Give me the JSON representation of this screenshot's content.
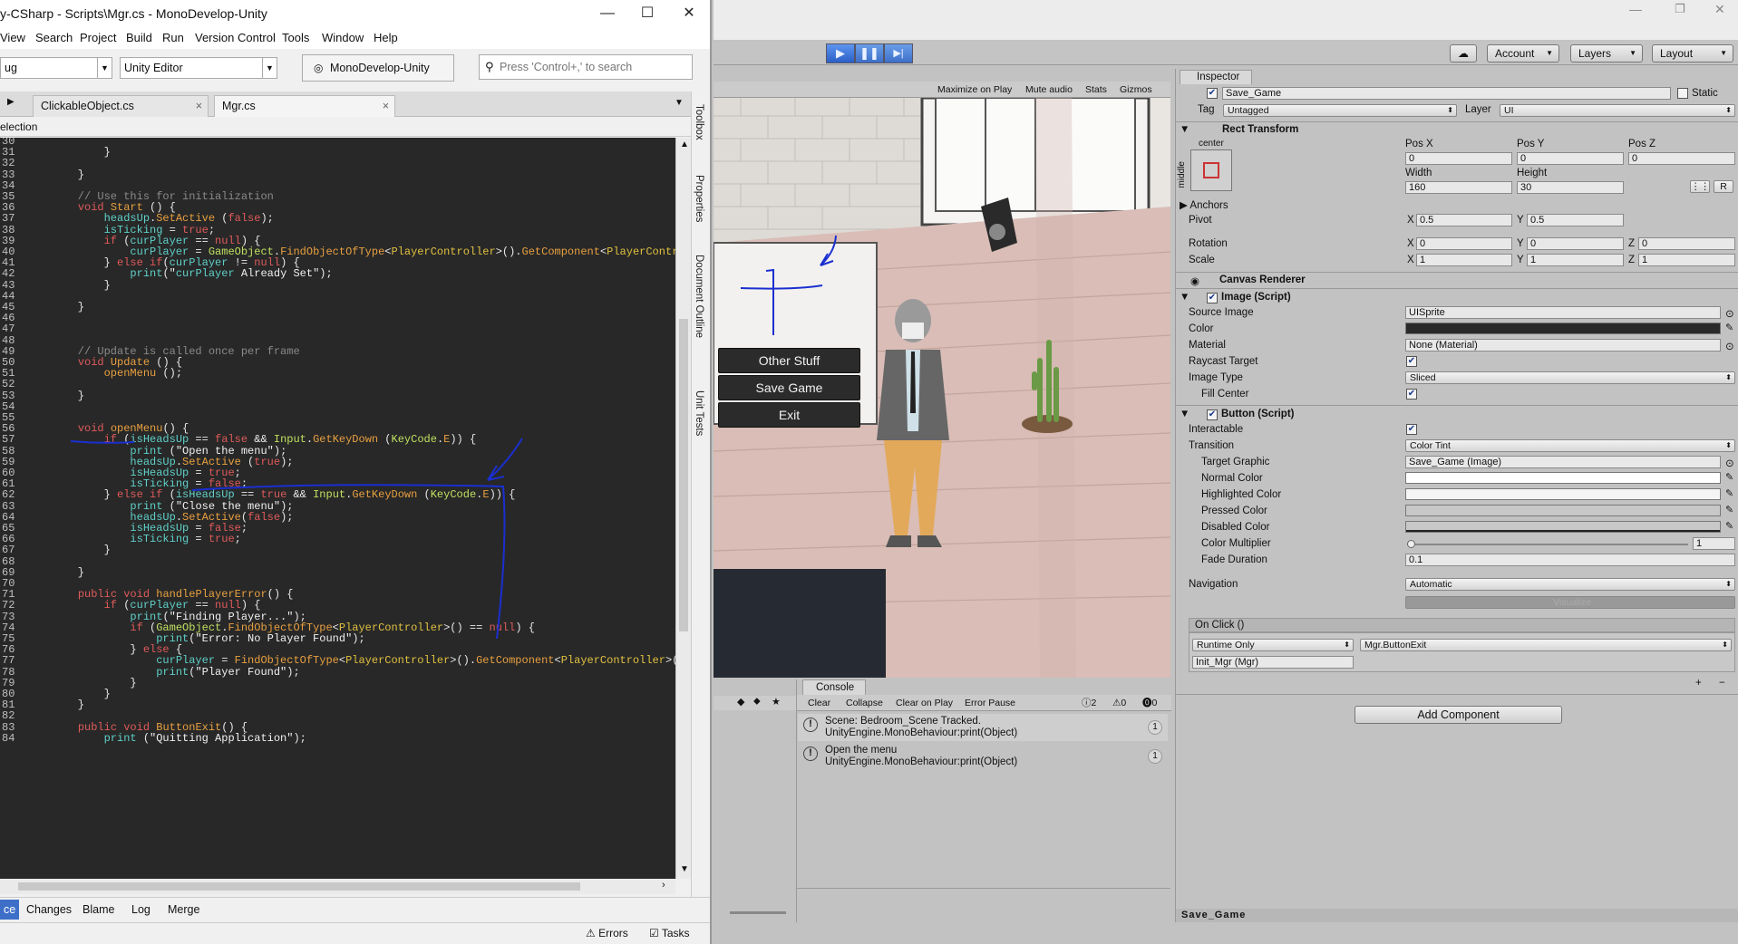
{
  "md": {
    "title": "y-CSharp - Scripts\\Mgr.cs - MonoDevelop-Unity",
    "window_controls": [
      "—",
      "☐",
      "✕"
    ],
    "menu": [
      "View",
      "Search",
      "Project",
      "Build",
      "Run",
      "Version Control",
      "Tools",
      "Window",
      "Help"
    ],
    "config": "ug",
    "target": "Unity Editor",
    "app_button": "MonoDevelop-Unity",
    "search_placeholder": "Press 'Control+,' to search",
    "tabs": [
      "ClickableObject.cs",
      "Mgr.cs"
    ],
    "tab_close": "×",
    "selection_label": "election",
    "side_tools": [
      "Toolbox",
      "Properties",
      "Document Outline",
      "Unit Tests"
    ],
    "bottom_tabs": [
      "ce",
      "Changes",
      "Blame",
      "Log",
      "Merge"
    ],
    "status": [
      "Errors",
      "Tasks"
    ],
    "code": [
      {
        "n": "30",
        "t": ""
      },
      {
        "n": "31",
        "t": "        }"
      },
      {
        "n": "32",
        "t": ""
      },
      {
        "n": "33",
        "t": "    }"
      },
      {
        "n": "34",
        "t": ""
      },
      {
        "n": "35",
        "t": "    // Use this for initialization",
        "c": "cm"
      },
      {
        "n": "36",
        "t": "    void Start () {"
      },
      {
        "n": "37",
        "t": "        headsUp.SetActive (false);"
      },
      {
        "n": "38",
        "t": "        isTicking = true;"
      },
      {
        "n": "39",
        "t": "        if (curPlayer == null) {"
      },
      {
        "n": "40",
        "t": "            curPlayer = GameObject.FindObjectOfType<PlayerController>().GetComponent<PlayerController>"
      },
      {
        "n": "41",
        "t": "        } else if(curPlayer != null) {"
      },
      {
        "n": "42",
        "t": "            print(\"curPlayer Already Set\");"
      },
      {
        "n": "43",
        "t": "        }"
      },
      {
        "n": "44",
        "t": ""
      },
      {
        "n": "45",
        "t": "    }"
      },
      {
        "n": "46",
        "t": ""
      },
      {
        "n": "47",
        "t": ""
      },
      {
        "n": "48",
        "t": ""
      },
      {
        "n": "49",
        "t": "    // Update is called once per frame",
        "c": "cm"
      },
      {
        "n": "50",
        "t": "    void Update () {"
      },
      {
        "n": "51",
        "t": "        openMenu ();"
      },
      {
        "n": "52",
        "t": ""
      },
      {
        "n": "53",
        "t": "    }"
      },
      {
        "n": "54",
        "t": ""
      },
      {
        "n": "55",
        "t": ""
      },
      {
        "n": "56",
        "t": "    void openMenu() {"
      },
      {
        "n": "57",
        "t": "        if (isHeadsUp == false && Input.GetKeyDown (KeyCode.E)) {"
      },
      {
        "n": "58",
        "t": "            print (\"Open the menu\");"
      },
      {
        "n": "59",
        "t": "            headsUp.SetActive (true);"
      },
      {
        "n": "60",
        "t": "            isHeadsUp = true;"
      },
      {
        "n": "61",
        "t": "            isTicking = false;"
      },
      {
        "n": "62",
        "t": "        } else if (isHeadsUp == true && Input.GetKeyDown (KeyCode.E)) {"
      },
      {
        "n": "63",
        "t": "            print (\"Close the menu\");"
      },
      {
        "n": "64",
        "t": "            headsUp.SetActive(false);"
      },
      {
        "n": "65",
        "t": "            isHeadsUp = false;"
      },
      {
        "n": "66",
        "t": "            isTicking = true;"
      },
      {
        "n": "67",
        "t": "        }"
      },
      {
        "n": "68",
        "t": ""
      },
      {
        "n": "69",
        "t": "    }"
      },
      {
        "n": "70",
        "t": ""
      },
      {
        "n": "71",
        "t": "    public void handlePlayerError() {"
      },
      {
        "n": "72",
        "t": "        if (curPlayer == null) {"
      },
      {
        "n": "73",
        "t": "            print(\"Finding Player...\");"
      },
      {
        "n": "74",
        "t": "            if (GameObject.FindObjectOfType<PlayerController>() == null) {"
      },
      {
        "n": "75",
        "t": "                print(\"Error: No Player Found\");"
      },
      {
        "n": "76",
        "t": "            } else {"
      },
      {
        "n": "77",
        "t": "                curPlayer = FindObjectOfType<PlayerController>().GetComponent<PlayerController>();"
      },
      {
        "n": "78",
        "t": "                print(\"Player Found\");"
      },
      {
        "n": "79",
        "t": "            }"
      },
      {
        "n": "80",
        "t": "        }"
      },
      {
        "n": "81",
        "t": "    }"
      },
      {
        "n": "82",
        "t": ""
      },
      {
        "n": "83",
        "t": "    public void ButtonExit() {"
      },
      {
        "n": "84",
        "t": "        print (\"Quitting Application\");"
      }
    ]
  },
  "unity": {
    "window_controls": [
      "—",
      "❐",
      "✕"
    ],
    "play_controls": [
      "▶",
      "❚❚",
      "▶|"
    ],
    "toolbar": {
      "cloud": "☁",
      "account": "Account",
      "layers": "Layers",
      "layout": "Layout"
    },
    "gamebar": [
      "Maximize on Play",
      "Mute audio",
      "Stats",
      "Gizmos"
    ],
    "menu_buttons": [
      "Other Stuff",
      "Save Game",
      "Exit"
    ],
    "console": {
      "tab": "Console",
      "buttons": [
        "Clear",
        "Collapse",
        "Clear on Play",
        "Error Pause"
      ],
      "counts": [
        "2",
        "0",
        "0"
      ],
      "rows": [
        {
          "text": "Scene: Bedroom_Scene Tracked.\nUnityEngine.MonoBehaviour:print(Object)",
          "count": "1"
        },
        {
          "text": "Open the menu\nUnityEngine.MonoBehaviour:print(Object)",
          "count": "1"
        }
      ]
    },
    "inspector": {
      "tab": "Inspector",
      "object_name": "Save_Game",
      "static": "Static",
      "tag_label": "Tag",
      "tag": "Untagged",
      "layer_label": "Layer",
      "layer": "UI",
      "rect_transform": "Rect Transform",
      "anchor_h": "center",
      "anchor_v": "middle",
      "pos_labels": [
        "Pos X",
        "Pos Y",
        "Pos Z"
      ],
      "pos": [
        "0",
        "0",
        "0"
      ],
      "size_labels": [
        "Width",
        "Height"
      ],
      "size": [
        "160",
        "30"
      ],
      "r_button": "R",
      "anchors": "Anchors",
      "pivot": "Pivot",
      "pivot_vals": [
        "0.5",
        "0.5"
      ],
      "rotation": "Rotation",
      "rotation_vals": [
        "0",
        "0",
        "0"
      ],
      "scale": "Scale",
      "scale_vals": [
        "1",
        "1",
        "1"
      ],
      "canvas_renderer": "Canvas Renderer",
      "image_script": "Image (Script)",
      "image_fields": {
        "source_image": "Source Image",
        "source_val": "UISprite",
        "color": "Color",
        "material": "Material",
        "material_val": "None (Material)",
        "raycast": "Raycast Target",
        "image_type": "Image Type",
        "image_type_val": "Sliced",
        "fill_center": "Fill Center"
      },
      "button_script": "Button (Script)",
      "button_fields": {
        "interactable": "Interactable",
        "transition": "Transition",
        "transition_val": "Color Tint",
        "target_graphic": "Target Graphic",
        "target_val": "Save_Game (Image)",
        "normal": "Normal Color",
        "highlighted": "Highlighted Color",
        "pressed": "Pressed Color",
        "disabled": "Disabled Color",
        "multiplier": "Color Multiplier",
        "multiplier_val": "1",
        "fade": "Fade Duration",
        "fade_val": "0.1",
        "navigation": "Navigation",
        "navigation_val": "Automatic",
        "visualize": "Visualize"
      },
      "onclick": "On Click ()",
      "runtime": "Runtime Only",
      "function": "Mgr.ButtonExit",
      "object_ref": "Init_Mgr (Mgr)",
      "add_component": "Add Component",
      "footer": "Save_Game"
    }
  }
}
